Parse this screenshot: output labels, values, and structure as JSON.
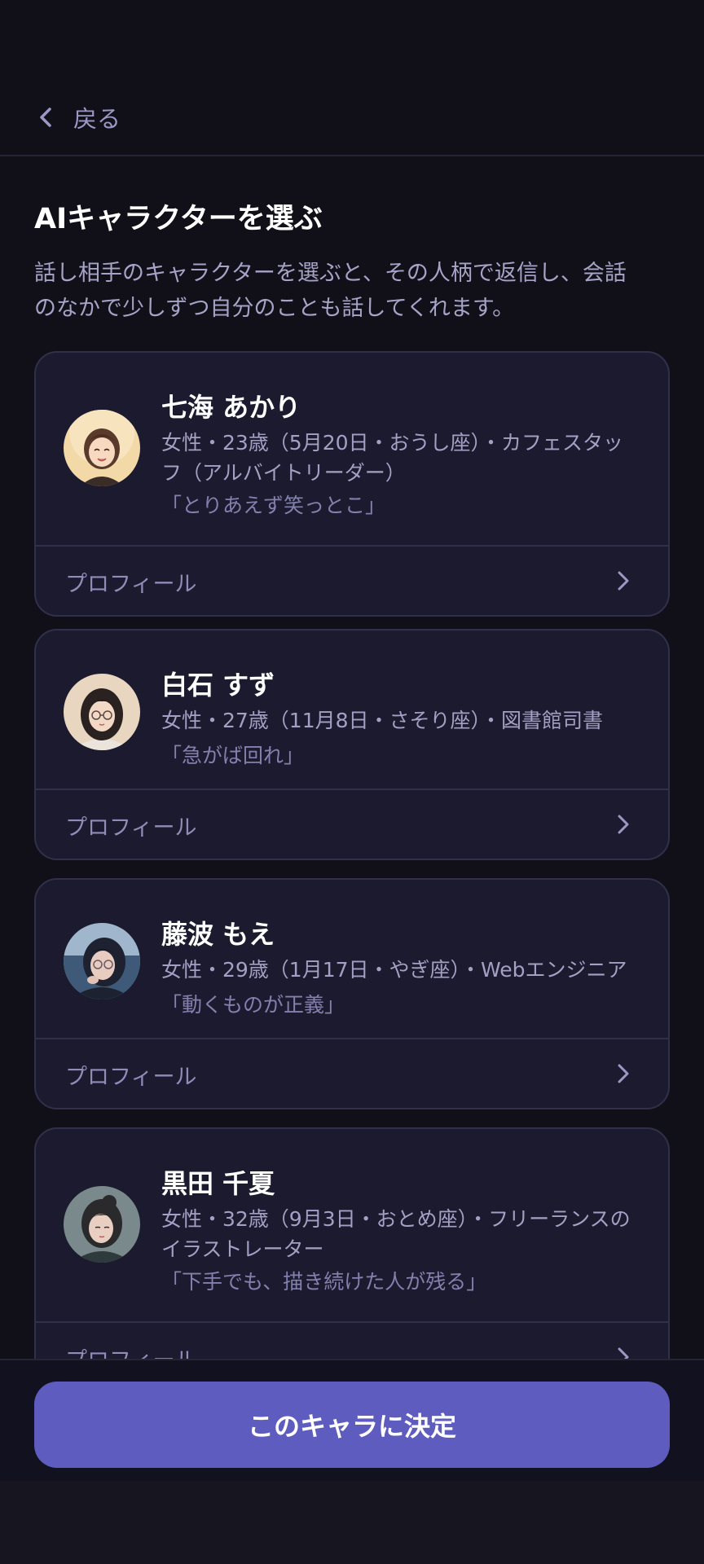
{
  "header": {
    "back_label": "戻る",
    "back_icon": "chevron-left-icon"
  },
  "page": {
    "title": "AIキャラクターを選ぶ",
    "description_lines": [
      "話し相手のキャラクターを選ぶと、その人柄で返信し、会話",
      "のなかで少しずつ自分のことも話してくれます。"
    ]
  },
  "characters": [
    {
      "name": "七海 あかり",
      "meta_lines": [
        "女性・23歳（5月20日・おうし座）・カフェスタッ",
        "フ（アルバイトリーダー）"
      ],
      "quote": "「とりあえず笑っとこ」",
      "profile_label": "プロフィール"
    },
    {
      "name": "白石 すず",
      "meta_lines": [
        "女性・27歳（11月8日・さそり座）・図書館司書"
      ],
      "quote": "「急がば回れ」",
      "profile_label": "プロフィール"
    },
    {
      "name": "藤波 もえ",
      "meta_lines": [
        "女性・29歳（1月17日・やぎ座）・Webエンジニア"
      ],
      "quote": "「動くものが正義」",
      "profile_label": "プロフィール"
    },
    {
      "name": "黒田 千夏",
      "meta_lines": [
        "女性・32歳（9月3日・おとめ座）・フリーランスの",
        "イラストレーター"
      ],
      "quote": "「下手でも、描き続けた人が残る」",
      "profile_label": "プロフィール"
    }
  ],
  "footer": {
    "confirm_label": "このキャラに決定"
  },
  "colors": {
    "accent": "#5e5dbf",
    "background": "#111019",
    "card": "#1b1a2e"
  }
}
